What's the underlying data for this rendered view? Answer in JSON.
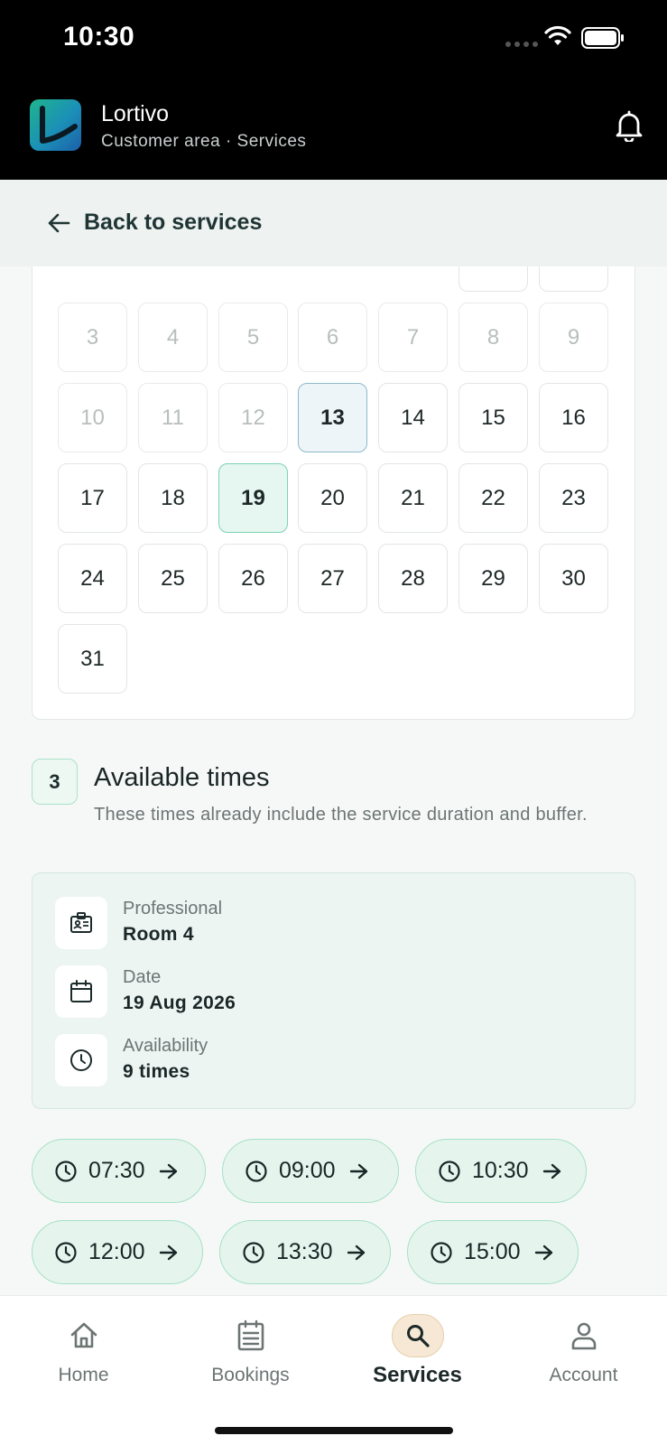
{
  "status_bar": {
    "time": "10:30"
  },
  "header": {
    "app_name": "Lortivo",
    "subtitle": "Customer area · Services"
  },
  "back": {
    "label": "Back to services"
  },
  "calendar": {
    "weeks": [
      [
        {
          "d": "3",
          "s": "disabled"
        },
        {
          "d": "4",
          "s": "disabled"
        },
        {
          "d": "5",
          "s": "disabled"
        },
        {
          "d": "6",
          "s": "disabled"
        },
        {
          "d": "7",
          "s": "disabled"
        },
        {
          "d": "8",
          "s": "disabled"
        },
        {
          "d": "9",
          "s": "disabled"
        }
      ],
      [
        {
          "d": "10",
          "s": "disabled"
        },
        {
          "d": "11",
          "s": "disabled"
        },
        {
          "d": "12",
          "s": "disabled"
        },
        {
          "d": "13",
          "s": "today"
        },
        {
          "d": "14",
          "s": ""
        },
        {
          "d": "15",
          "s": ""
        },
        {
          "d": "16",
          "s": ""
        }
      ],
      [
        {
          "d": "17",
          "s": ""
        },
        {
          "d": "18",
          "s": ""
        },
        {
          "d": "19",
          "s": "selected"
        },
        {
          "d": "20",
          "s": ""
        },
        {
          "d": "21",
          "s": ""
        },
        {
          "d": "22",
          "s": ""
        },
        {
          "d": "23",
          "s": ""
        }
      ],
      [
        {
          "d": "24",
          "s": ""
        },
        {
          "d": "25",
          "s": ""
        },
        {
          "d": "26",
          "s": ""
        },
        {
          "d": "27",
          "s": ""
        },
        {
          "d": "28",
          "s": ""
        },
        {
          "d": "29",
          "s": ""
        },
        {
          "d": "30",
          "s": ""
        }
      ],
      [
        {
          "d": "31",
          "s": ""
        }
      ]
    ]
  },
  "times_section": {
    "step": "3",
    "title": "Available times",
    "description": "These times already include the service duration and buffer."
  },
  "summary": {
    "professional_label": "Professional",
    "professional_value": "Room 4",
    "date_label": "Date",
    "date_value": "19 Aug 2026",
    "availability_label": "Availability",
    "availability_value": "9 times"
  },
  "slots": [
    "07:30",
    "09:00",
    "10:30",
    "12:00",
    "13:30",
    "15:00"
  ],
  "nav": {
    "home": "Home",
    "bookings": "Bookings",
    "services": "Services",
    "account": "Account"
  },
  "colors": {
    "accent": "#7bd3b1",
    "active_nav": "#f6e8d4",
    "header_bg": "#000000"
  }
}
